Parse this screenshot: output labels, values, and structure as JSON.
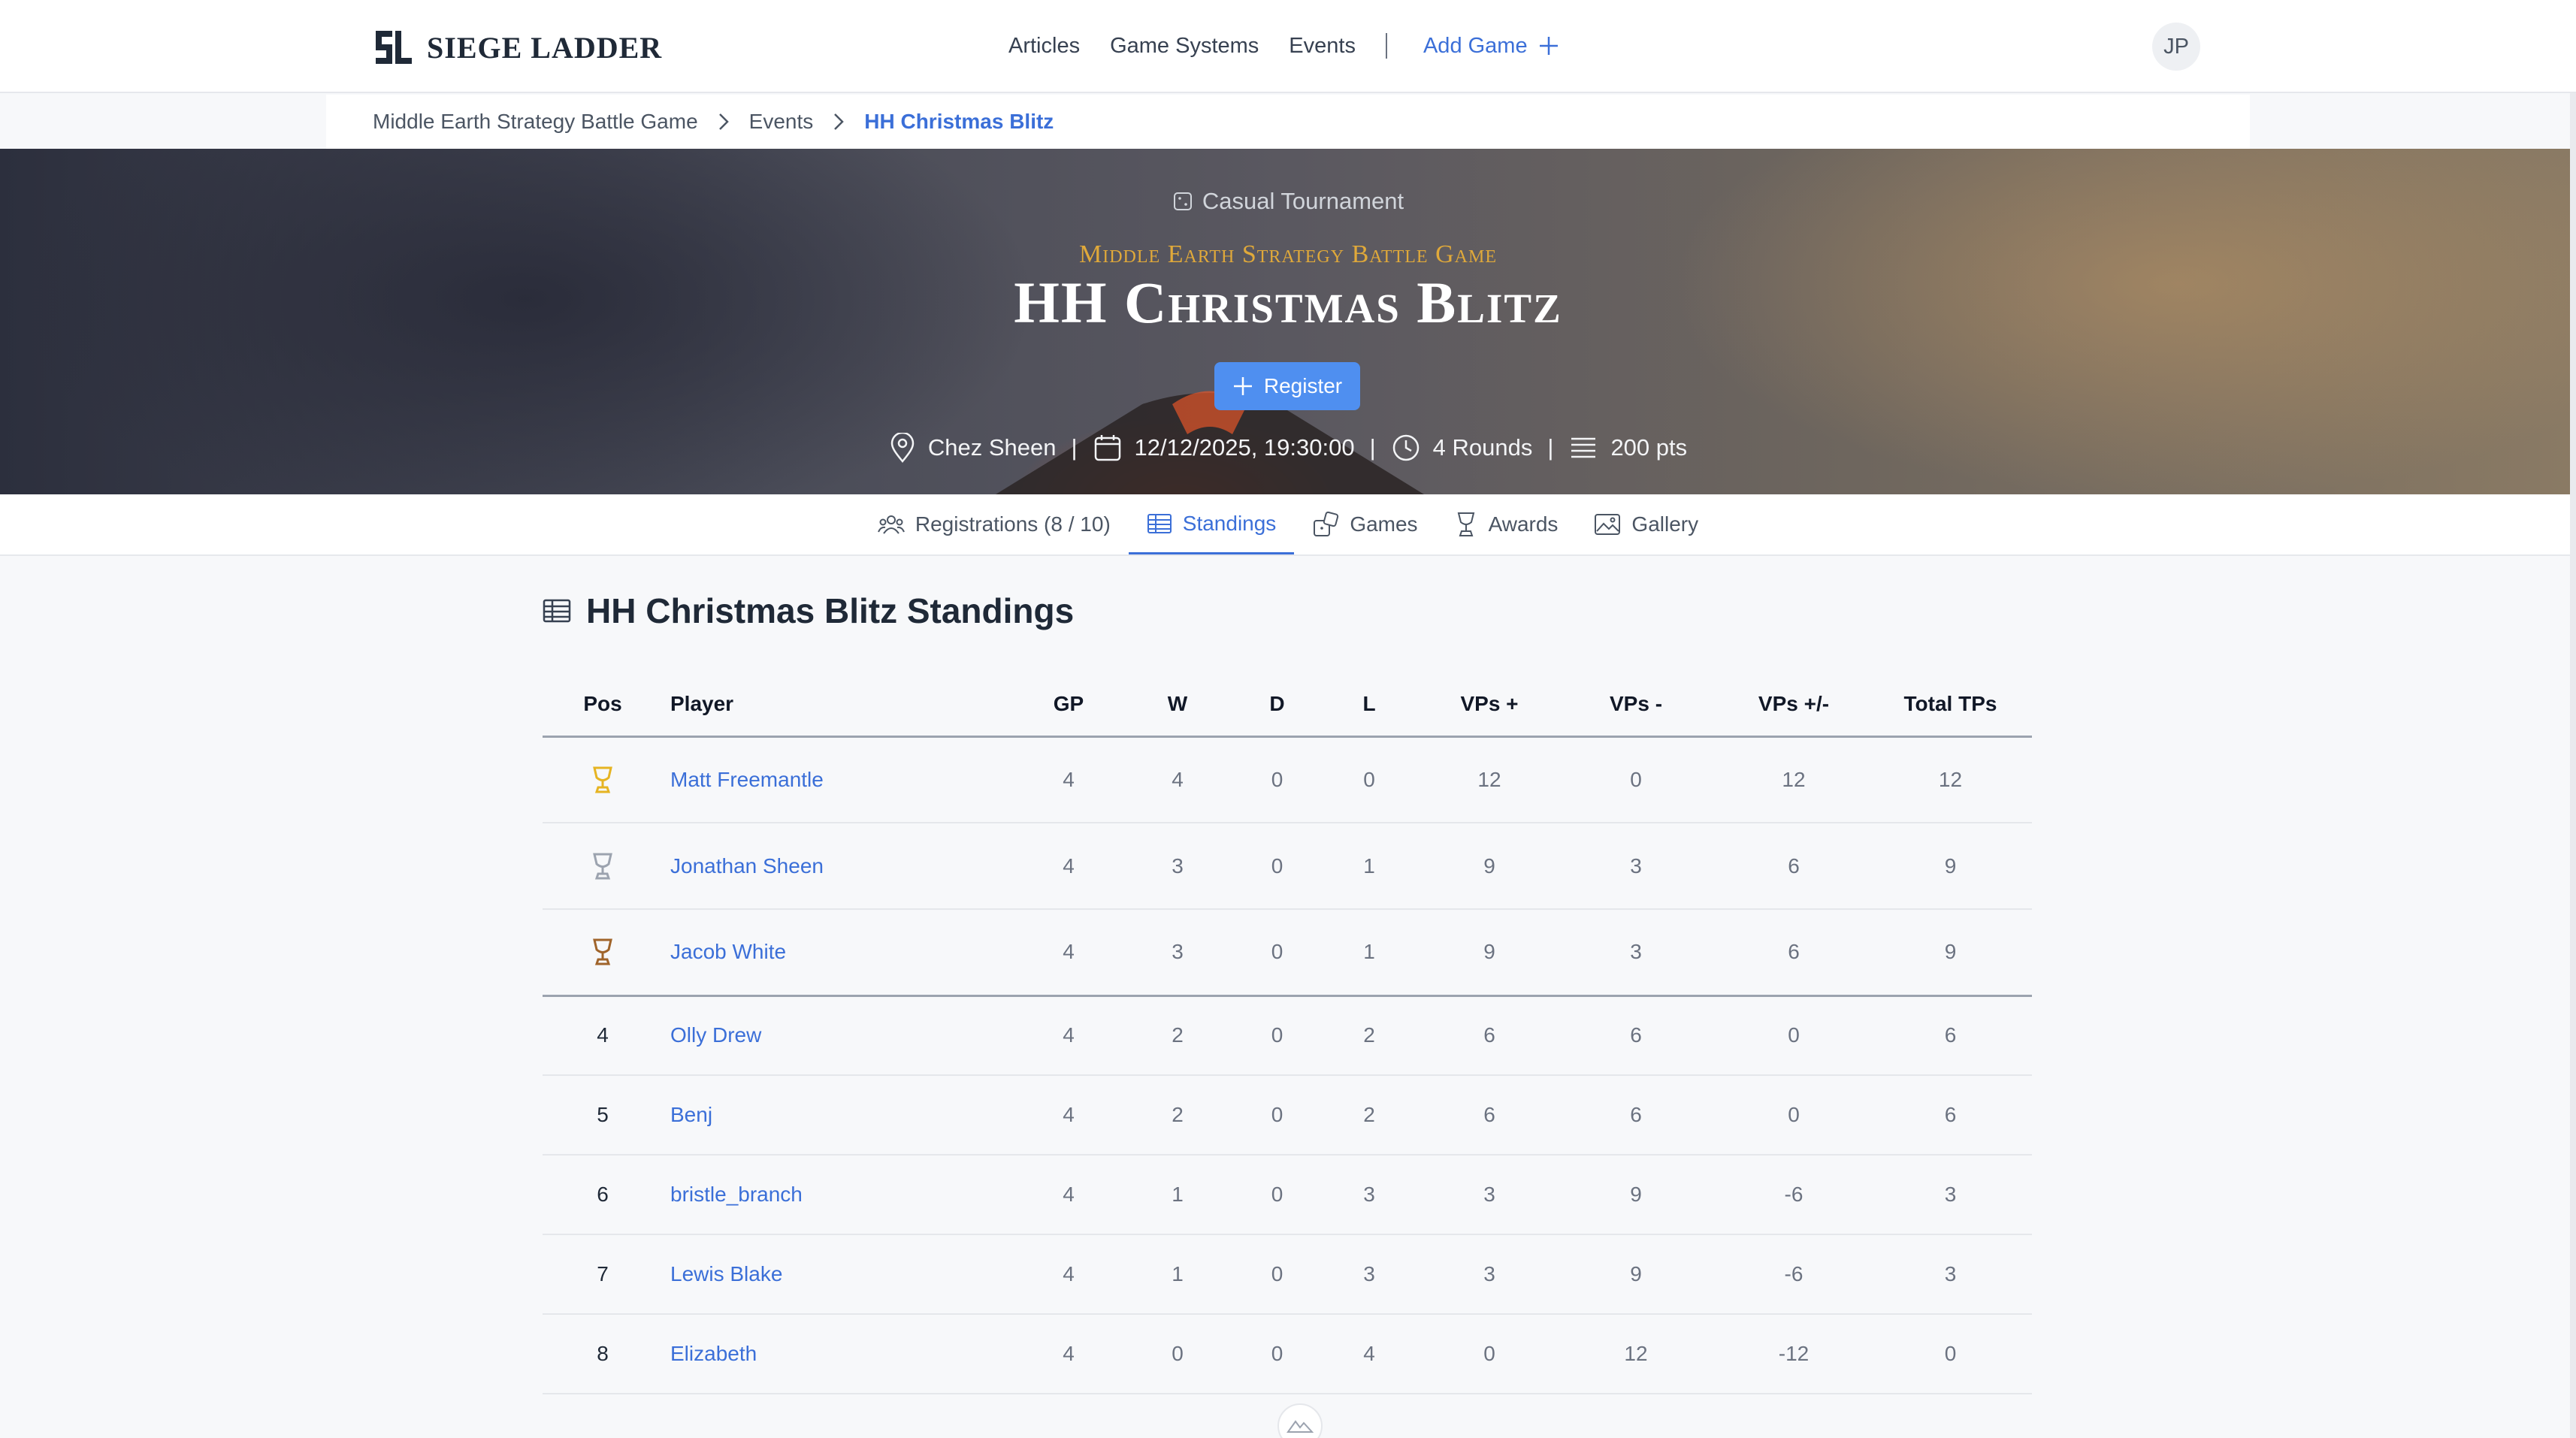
{
  "brand": {
    "name": "SIEGE LADDER"
  },
  "nav": {
    "articles": "Articles",
    "game_systems": "Game Systems",
    "events": "Events",
    "add_game": "Add Game"
  },
  "user": {
    "initials": "JP"
  },
  "breadcrumb": {
    "items": [
      "Middle Earth Strategy Battle Game",
      "Events"
    ],
    "current": "HH Christmas Blitz"
  },
  "event": {
    "type": "Casual Tournament",
    "game": "Middle Earth Strategy Battle Game",
    "title": "HH Christmas Blitz",
    "register_label": "Register",
    "location": "Chez Sheen",
    "datetime": "12/12/2025, 19:30:00",
    "rounds": "4 Rounds",
    "points": "200 pts",
    "separator": "|"
  },
  "tabs": [
    {
      "label": "Registrations (8 / 10)",
      "icon": "users-icon",
      "active": false
    },
    {
      "label": "Standings",
      "icon": "table-icon",
      "active": true
    },
    {
      "label": "Games",
      "icon": "dice-icon",
      "active": false
    },
    {
      "label": "Awards",
      "icon": "trophy-icon",
      "active": false
    },
    {
      "label": "Gallery",
      "icon": "image-icon",
      "active": false
    }
  ],
  "standings": {
    "title": "HH Christmas Blitz Standings",
    "columns": [
      "Pos",
      "Player",
      "GP",
      "W",
      "D",
      "L",
      "VPs +",
      "VPs -",
      "VPs +/-",
      "Total TPs"
    ],
    "rows": [
      {
        "pos": "",
        "trophy": "gold",
        "player": "Matt Freemantle",
        "gp": "4",
        "w": "4",
        "d": "0",
        "l": "0",
        "vp_plus": "12",
        "vp_minus": "0",
        "vp_diff": "12",
        "tps": "12"
      },
      {
        "pos": "",
        "trophy": "silver",
        "player": "Jonathan Sheen",
        "gp": "4",
        "w": "3",
        "d": "0",
        "l": "1",
        "vp_plus": "9",
        "vp_minus": "3",
        "vp_diff": "6",
        "tps": "9"
      },
      {
        "pos": "",
        "trophy": "bronze",
        "player": "Jacob White",
        "gp": "4",
        "w": "3",
        "d": "0",
        "l": "1",
        "vp_plus": "9",
        "vp_minus": "3",
        "vp_diff": "6",
        "tps": "9"
      },
      {
        "pos": "4",
        "trophy": "",
        "player": "Olly Drew",
        "gp": "4",
        "w": "2",
        "d": "0",
        "l": "2",
        "vp_plus": "6",
        "vp_minus": "6",
        "vp_diff": "0",
        "tps": "6"
      },
      {
        "pos": "5",
        "trophy": "",
        "player": "Benj",
        "gp": "4",
        "w": "2",
        "d": "0",
        "l": "2",
        "vp_plus": "6",
        "vp_minus": "6",
        "vp_diff": "0",
        "tps": "6"
      },
      {
        "pos": "6",
        "trophy": "",
        "player": "bristle_branch",
        "gp": "4",
        "w": "1",
        "d": "0",
        "l": "3",
        "vp_plus": "3",
        "vp_minus": "9",
        "vp_diff": "-6",
        "tps": "3"
      },
      {
        "pos": "7",
        "trophy": "",
        "player": "Lewis Blake",
        "gp": "4",
        "w": "1",
        "d": "0",
        "l": "3",
        "vp_plus": "3",
        "vp_minus": "9",
        "vp_diff": "-6",
        "tps": "3"
      },
      {
        "pos": "8",
        "trophy": "",
        "player": "Elizabeth",
        "gp": "4",
        "w": "0",
        "d": "0",
        "l": "4",
        "vp_plus": "0",
        "vp_minus": "12",
        "vp_diff": "-12",
        "tps": "0"
      }
    ]
  },
  "colors": {
    "accent": "#3b6fd8",
    "register_button": "#4f8ff0",
    "gold": "#e6b422",
    "silver": "#9ca3af",
    "bronze": "#a0642a",
    "game_subtitle": "#e0a93a"
  }
}
